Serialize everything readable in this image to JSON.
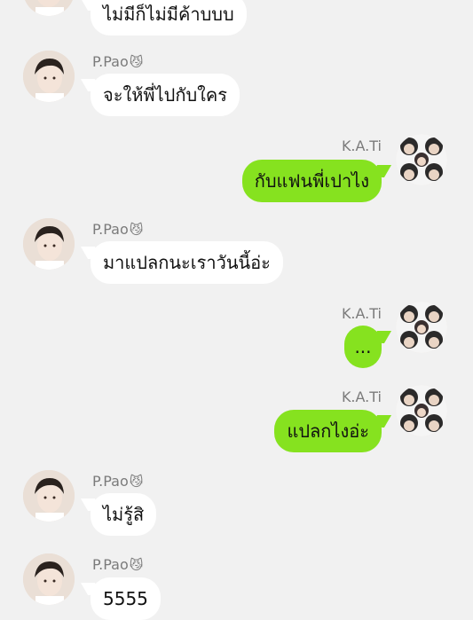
{
  "contacts": {
    "friend": {
      "name": "P.Pao",
      "emoji": "😼"
    },
    "me": {
      "name": "K.A.Ti"
    }
  },
  "messages": [
    {
      "sender": "friend",
      "text": "ไม่มีก็ไม่มีค้าบบบ",
      "show_name": false
    },
    {
      "sender": "friend",
      "text": "จะให้พี่ไปกับใคร",
      "show_name": true
    },
    {
      "sender": "me",
      "text": "กับแฟนพี่เปาไง",
      "show_name": true
    },
    {
      "sender": "friend",
      "text": "มาแปลกนะเราวันนี้อ่ะ",
      "show_name": true
    },
    {
      "sender": "me",
      "text": "...",
      "show_name": true
    },
    {
      "sender": "me",
      "text": "แปลกไงอ่ะ",
      "show_name": true
    },
    {
      "sender": "friend",
      "text": "ไม่รู้สิ",
      "show_name": true
    },
    {
      "sender": "friend",
      "text": "5555",
      "show_name": true
    }
  ]
}
